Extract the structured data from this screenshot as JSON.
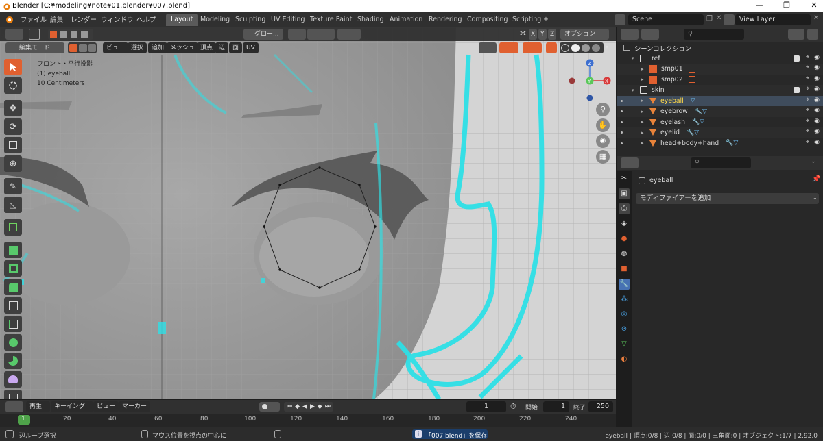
{
  "titlebar": {
    "title": "Blender [C:¥modeling¥note¥01.blender¥007.blend]",
    "minimize": "—",
    "restore": "❐",
    "close": "✕"
  },
  "menu": {
    "items": [
      "ファイル",
      "編集",
      "レンダー",
      "ウィンドウ",
      "ヘルプ"
    ]
  },
  "workspaces": {
    "tabs": [
      "Layout",
      "Modeling",
      "Sculpting",
      "UV Editing",
      "Texture Paint",
      "Shading",
      "Animation",
      "Rendering",
      "Compositing",
      "Scripting"
    ],
    "active": "Layout",
    "add": "+"
  },
  "scene": {
    "label": "Scene",
    "view_layer": "View Layer"
  },
  "viewport": {
    "mode": "編集モード",
    "menus": [
      "ビュー",
      "選択",
      "追加",
      "メッシュ",
      "頂点",
      "辺",
      "面",
      "UV"
    ],
    "orientation": "グロー...",
    "axes": [
      "X",
      "Y",
      "Z"
    ],
    "options": "オプション",
    "overlay_lines": [
      "フロント・平行投影",
      "(1) eyeball",
      "10 Centimeters"
    ],
    "gizmo": {
      "z": "Z",
      "y": "Y",
      "x": "X"
    }
  },
  "outliner": {
    "title": "シーンコレクション",
    "rows": [
      {
        "name": "ref",
        "depth": 1,
        "type": "collection"
      },
      {
        "name": "smp01",
        "depth": 2,
        "type": "image"
      },
      {
        "name": "smp02",
        "depth": 2,
        "type": "image"
      },
      {
        "name": "skin",
        "depth": 1,
        "type": "collection"
      },
      {
        "name": "eyeball",
        "depth": 2,
        "type": "mesh",
        "selected": true
      },
      {
        "name": "eyebrow",
        "depth": 2,
        "type": "mesh"
      },
      {
        "name": "eyelash",
        "depth": 2,
        "type": "mesh"
      },
      {
        "name": "eyelid",
        "depth": 2,
        "type": "mesh"
      },
      {
        "name": "head+body+hand",
        "depth": 2,
        "type": "mesh"
      }
    ]
  },
  "properties": {
    "object_name": "eyeball",
    "add_modifier": "モディファイアーを追加"
  },
  "timeline": {
    "menus": [
      "再生",
      "キーイング",
      "ビュー",
      "マーカー"
    ],
    "current_frame": "1",
    "start_label": "開始",
    "start": "1",
    "end_label": "終了",
    "end": "250",
    "ticks": [
      "1",
      "20",
      "40",
      "60",
      "80",
      "100",
      "120",
      "140",
      "160",
      "180",
      "200",
      "220",
      "240"
    ]
  },
  "status": {
    "left": "辺ループ選択",
    "middle": "マウス位置を視点の中心に",
    "save_msg": "「007.blend」を保存",
    "info": "eyeball | 頂点:0/8 | 辺:0/8 | 面:0/0 | 三角面:0 | オブジェクト:1/7 | 2.92.0"
  },
  "colors": {
    "accent": "#e06030",
    "cyan": "#2ee0e6",
    "selected_text": "#ffd94a",
    "mesh_orange": "#e8833a"
  }
}
